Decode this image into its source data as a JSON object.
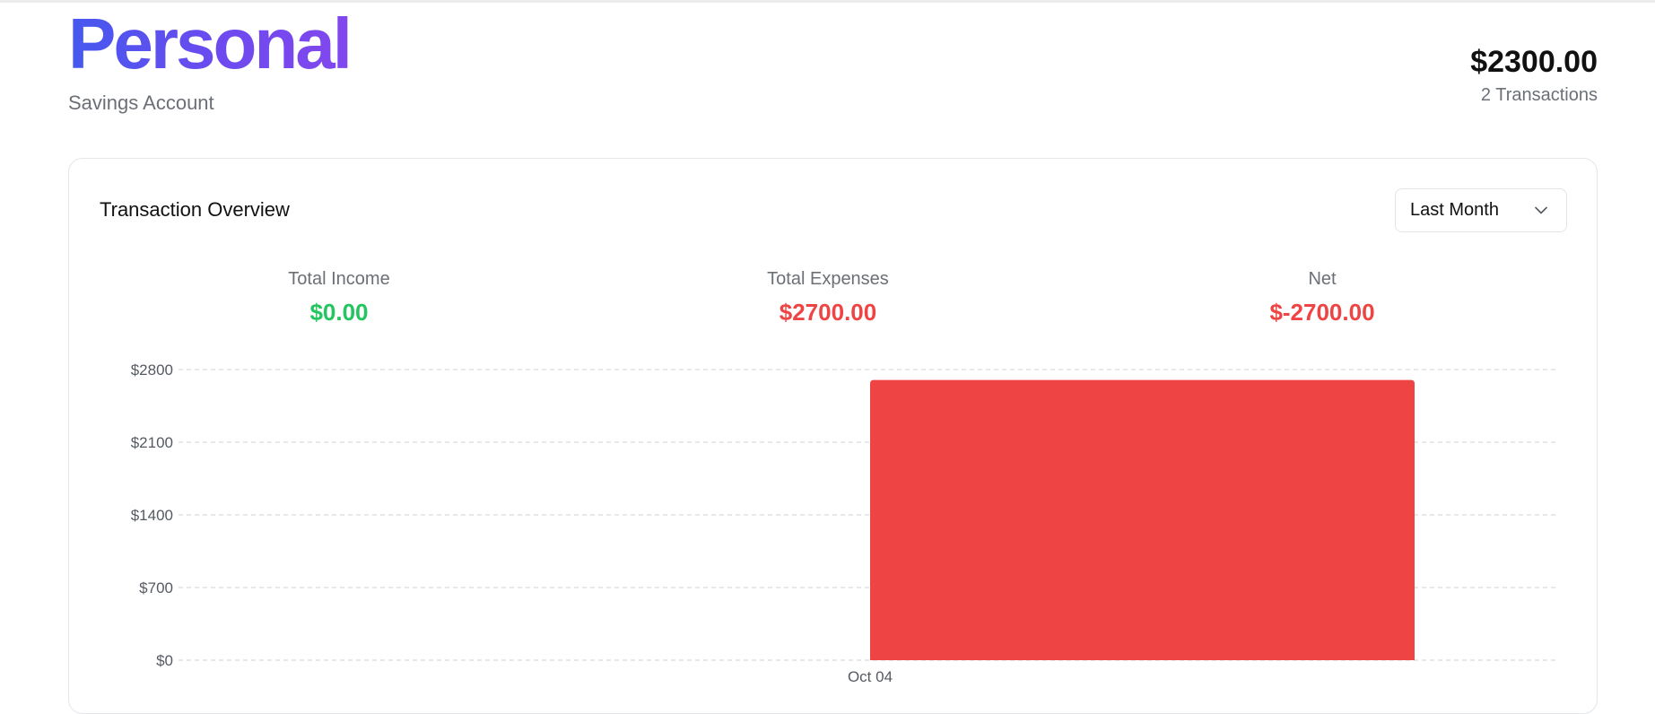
{
  "header": {
    "account_name": "Personal",
    "account_type": "Savings Account",
    "balance": "$2300.00",
    "transaction_count": "2 Transactions"
  },
  "overview": {
    "title": "Transaction Overview",
    "period_selected": "Last Month",
    "stats": [
      {
        "label": "Total Income",
        "value": "$0.00",
        "color": "#22c55e"
      },
      {
        "label": "Total Expenses",
        "value": "$2700.00",
        "color": "#ef4444"
      },
      {
        "label": "Net",
        "value": "$-2700.00",
        "color": "#ef4444"
      }
    ]
  },
  "icons": {
    "period_dropdown": "chevron-down-icon"
  },
  "chart_data": {
    "type": "bar",
    "categories": [
      "Oct 04"
    ],
    "series": [
      {
        "values": [
          2700
        ],
        "color": "#ef4444"
      }
    ],
    "yticks": [
      0,
      700,
      1400,
      2100,
      2800
    ],
    "ytick_labels": [
      "$0",
      "$700",
      "$1400",
      "$2100",
      "$2800"
    ],
    "ylim": [
      0,
      2800
    ],
    "grid": true,
    "grid_style": "dashed"
  }
}
